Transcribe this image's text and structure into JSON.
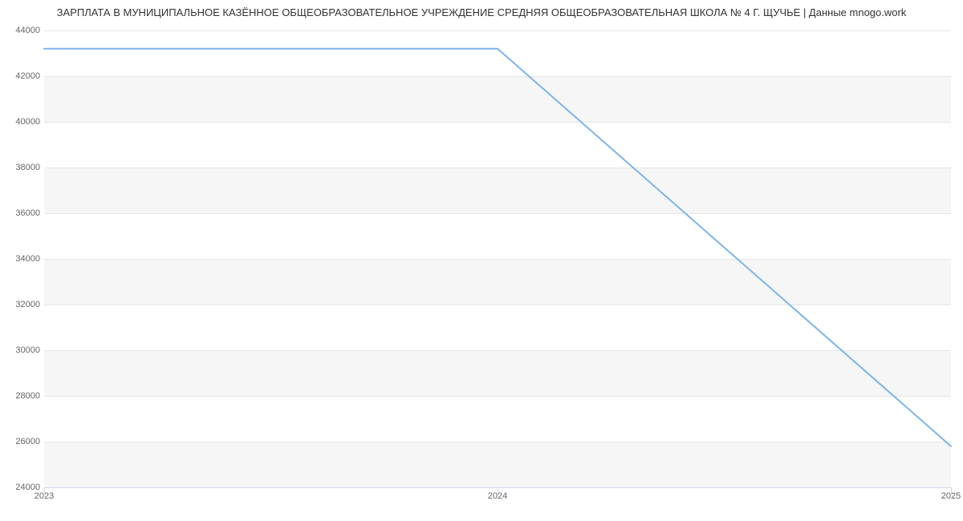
{
  "chart_data": {
    "type": "line",
    "title": "ЗАРПЛАТА В МУНИЦИПАЛЬНОЕ КАЗЁННОЕ ОБЩЕОБРАЗОВАТЕЛЬНОЕ УЧРЕЖДЕНИЕ СРЕДНЯЯ ОБЩЕОБРАЗОВАТЕЛЬНАЯ ШКОЛА № 4 Г. ЩУЧЬЕ | Данные mnogo.work",
    "x": [
      2023,
      2024,
      2025
    ],
    "values": [
      43200,
      43200,
      25800
    ],
    "x_ticks": [
      2023,
      2024,
      2025
    ],
    "y_ticks": [
      24000,
      26000,
      28000,
      30000,
      32000,
      34000,
      36000,
      38000,
      40000,
      42000,
      44000
    ],
    "xlim": [
      2023,
      2025
    ],
    "ylim": [
      24000,
      44000
    ],
    "xlabel": "",
    "ylabel": "",
    "grid": true
  }
}
